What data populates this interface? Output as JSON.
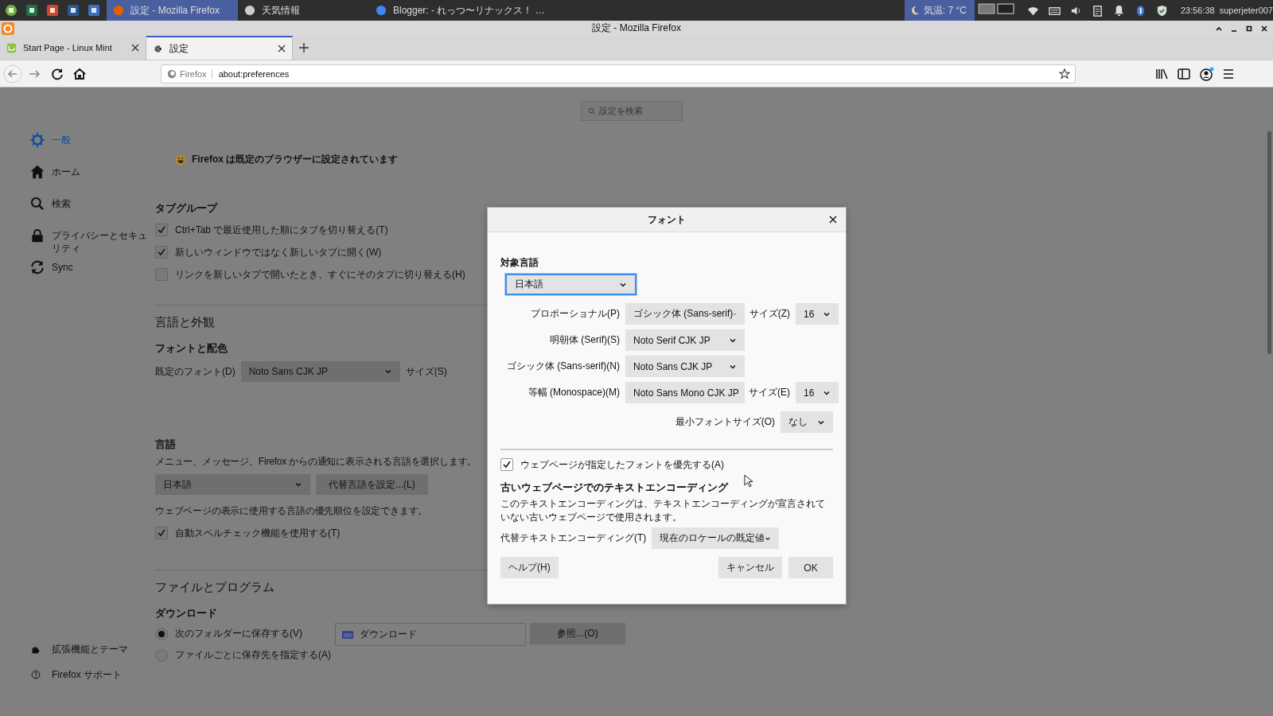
{
  "taskbar": {
    "windows": [
      {
        "title": "設定 - Mozilla Firefox",
        "selected": true
      },
      {
        "title": "天気情報",
        "selected": false
      },
      {
        "title": "Blogger: - れっつ〜リナックス！ …",
        "selected": false
      }
    ],
    "weather": "気温: 7 °C",
    "clock": "23:56:38",
    "user": "superjeter007"
  },
  "window": {
    "title": "設定 - Mozilla Firefox"
  },
  "tabs": [
    {
      "label": "Start Page - Linux Mint",
      "selected": false
    },
    {
      "label": "設定",
      "selected": true
    }
  ],
  "address_bar": {
    "identity": "Firefox",
    "value": "about:preferences"
  },
  "search": {
    "placeholder": "設定を検索"
  },
  "sidebar": {
    "items": [
      {
        "label": "一般",
        "selected": true
      },
      {
        "label": "ホーム",
        "selected": false
      },
      {
        "label": "検索",
        "selected": false
      },
      {
        "label": "プライバシーとセキュリティ",
        "selected": false
      },
      {
        "label": "Sync",
        "selected": false
      }
    ],
    "footer": [
      "拡張機能とテーマ",
      "Firefox サポート"
    ]
  },
  "content": {
    "default_browser_note": "Firefox は既定のブラウザーに設定されています",
    "tab_group": {
      "heading": "タブグループ",
      "options": [
        {
          "label": "Ctrl+Tab で最近使用した順にタブを切り替える(T)",
          "checked": true
        },
        {
          "label": "新しいウィンドウではなく新しいタブに開く(W)",
          "checked": true
        },
        {
          "label": "リンクを新しいタブで開いたとき、すぐにそのタブに切り替える(H)",
          "checked": false
        }
      ]
    },
    "appearance_heading": "言語と外観",
    "fonts": {
      "heading": "フォントと配色",
      "default_label": "既定のフォント(D)",
      "default_value": "Noto Sans CJK JP",
      "size_label": "サイズ(S)"
    },
    "language": {
      "heading": "言語",
      "description": "メニュー、メッセージ、Firefox からの通知に表示される言語を選択します。",
      "value": "日本語",
      "alternatives_button": "代替言語を設定...(L)",
      "note": "ウェブページの表示に使用する言語の優先順位を設定できます。",
      "spellcheck": {
        "label": "自動スペルチェック機能を使用する(T)",
        "checked": true
      }
    },
    "files_heading": "ファイルとプログラム",
    "downloads": {
      "heading": "ダウンロード",
      "options": [
        {
          "label": "次のフォルダーに保存する(V)",
          "selected": true
        },
        {
          "label": "ファイルごとに保存先を指定する(A)",
          "selected": false
        }
      ],
      "folder": "ダウンロード",
      "browse_button": "参照...(O)"
    }
  },
  "dialog": {
    "title": "フォント",
    "language_label": "対象言語",
    "language_value": "日本語",
    "rows": [
      {
        "label": "プロポーショナル(P)",
        "value": "ゴシック体 (Sans-serif)",
        "size_label": "サイズ(Z)",
        "size_value": "16"
      },
      {
        "label": "明朝体 (Serif)(S)",
        "value": "Noto Serif CJK JP"
      },
      {
        "label": "ゴシック体 (Sans-serif)(N)",
        "value": "Noto Sans CJK JP"
      },
      {
        "label": "等幅 (Monospace)(M)",
        "value": "Noto Sans Mono CJK JP",
        "size_label": "サイズ(E)",
        "size_value": "16"
      }
    ],
    "min_size_label": "最小フォントサイズ(O)",
    "min_size_value": "なし",
    "allow_page_fonts": {
      "label": "ウェブページが指定したフォントを優先する(A)",
      "checked": true
    },
    "encoding_heading": "古いウェブページでのテキストエンコーディング",
    "encoding_description": "このテキストエンコーディングは、テキストエンコーディングが宣言されていない古いウェブページで使用されます。",
    "fallback_label": "代替テキストエンコーディング(T)",
    "fallback_value": "現在のロケールの既定値",
    "buttons": {
      "help": "ヘルプ(H)",
      "cancel": "キャンセル",
      "ok": "OK"
    }
  }
}
